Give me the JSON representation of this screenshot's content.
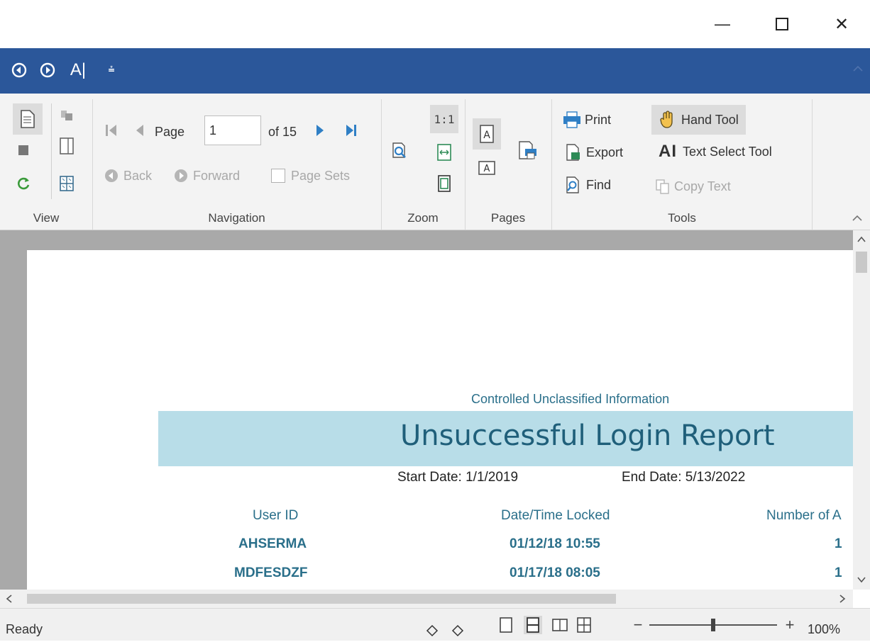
{
  "window": {
    "minimize_glyph": "—",
    "maximize_glyph": "☐",
    "close_glyph": "✕"
  },
  "quick_access": {
    "back_icon": "back-circle-icon",
    "forward_icon": "forward-circle-icon",
    "text_select_glyph": "A|",
    "customize_glyph": "⩮"
  },
  "ribbon": {
    "groups": {
      "view": "View",
      "navigation": "Navigation",
      "zoom": "Zoom",
      "pages": "Pages",
      "tools": "Tools"
    },
    "navigation": {
      "page_label": "Page",
      "page_value": "1",
      "of_label": "of 15",
      "back_label": "Back",
      "forward_label": "Forward",
      "page_sets_label": "Page Sets"
    },
    "zoom": {
      "actual_size_label": "1:1"
    },
    "tools": {
      "print_label": "Print",
      "export_label": "Export",
      "find_label": "Find",
      "hand_tool_label": "Hand Tool",
      "text_select_label": "Text Select Tool",
      "text_select_glyph": "AI",
      "copy_text_label": "Copy Text"
    }
  },
  "report": {
    "classification": "Controlled Unclassified Information",
    "title": "Unsuccessful Login Report",
    "start_date": "Start Date: 1/1/2019",
    "end_date": "End Date: 5/13/2022",
    "columns": [
      "User ID",
      "Date/Time Locked",
      "Number of A"
    ],
    "rows": [
      {
        "user": "AHSERMA",
        "datetime": "01/12/18 10:55",
        "count": "1"
      },
      {
        "user": "MDFESDZF",
        "datetime": "01/17/18 08:05",
        "count": "1"
      }
    ]
  },
  "status": {
    "text": "Ready",
    "zoom": "100%",
    "zoom_level_percent": 100
  },
  "colors": {
    "qat_bar": "#2b579a",
    "report_band": "#b8dde8",
    "report_text": "#2a6f8a",
    "doc_bg": "#a9a9a9"
  }
}
